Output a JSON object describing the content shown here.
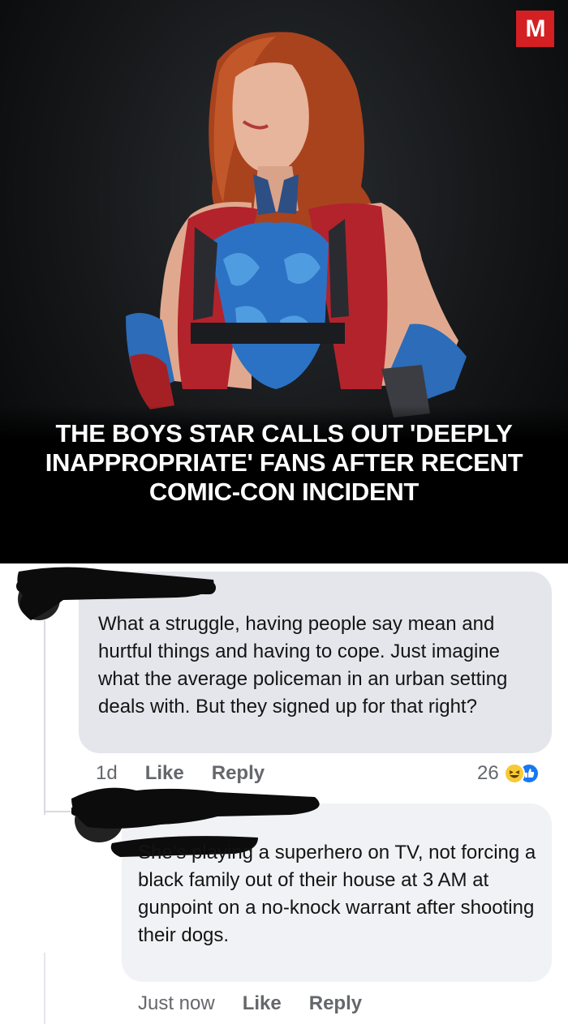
{
  "article": {
    "brand_badge": "M",
    "headline": "THE BOYS STAR CALLS OUT 'DEEPLY INAPPROPRIATE' FANS AFTER RECENT COMIC-CON INCIDENT",
    "colors": {
      "badge": "#d41f23",
      "background": "#0b0c0d"
    }
  },
  "comments": [
    {
      "text": "What a struggle, having people say mean and hurtful things and having to cope. Just imagine what the average policeman in an urban setting deals with. But they signed up for that right?",
      "time": "1d",
      "like_label": "Like",
      "reply_label": "Reply",
      "reaction_count": "26",
      "reaction_icons": [
        "haha-icon",
        "like-icon"
      ]
    },
    {
      "text": "She's playing a superhero on TV, not forcing a black family out of their house at 3 AM at gunpoint on a no-knock warrant after shooting their dogs.",
      "time": "Just now",
      "like_label": "Like",
      "reply_label": "Reply"
    }
  ]
}
